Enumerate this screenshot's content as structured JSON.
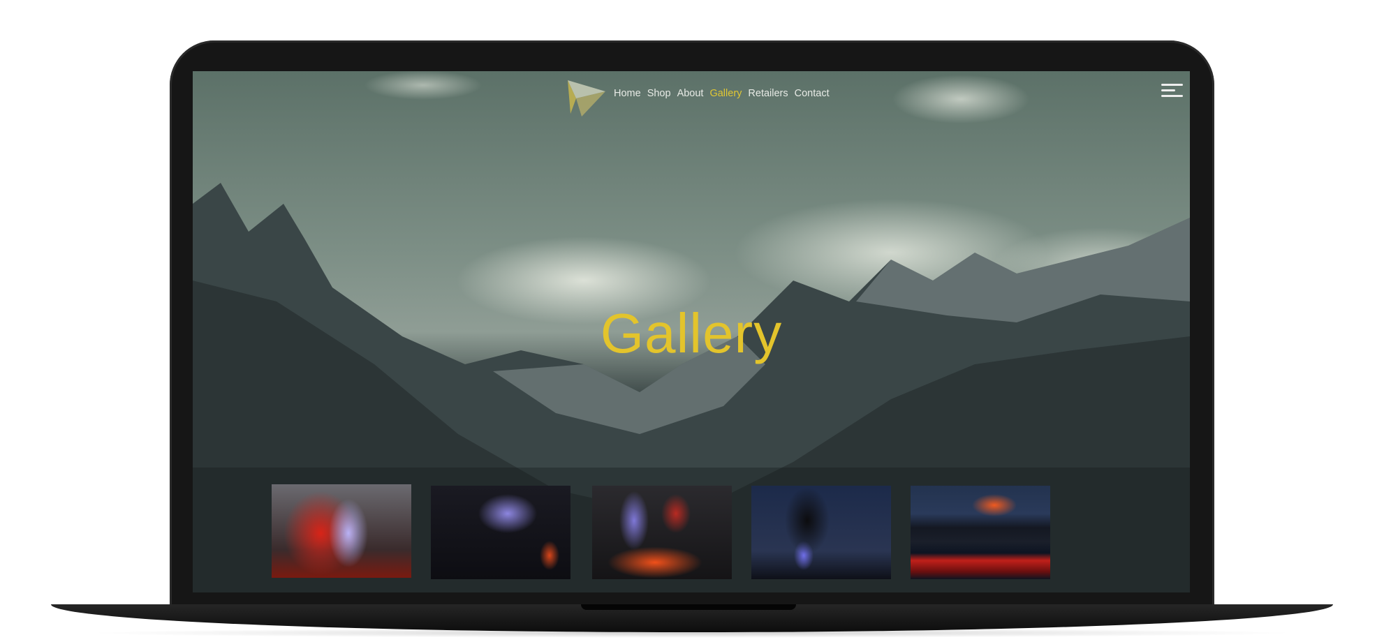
{
  "nav": {
    "items": [
      {
        "label": "Home",
        "active": false
      },
      {
        "label": "Shop",
        "active": false
      },
      {
        "label": "About",
        "active": false
      },
      {
        "label": "Gallery",
        "active": true
      },
      {
        "label": "Retailers",
        "active": false
      },
      {
        "label": "Contact",
        "active": false
      }
    ]
  },
  "hero": {
    "title": "Gallery"
  },
  "colors": {
    "accent": "#e0c734",
    "nav_text": "#e8ebe6"
  },
  "thumbnails": [
    {
      "subject": "volcano-lightning-red"
    },
    {
      "subject": "volcano-lightning-dark"
    },
    {
      "subject": "volcano-lava-lightning"
    },
    {
      "subject": "volcano-ash-night"
    },
    {
      "subject": "volcano-eruption-lake"
    }
  ]
}
